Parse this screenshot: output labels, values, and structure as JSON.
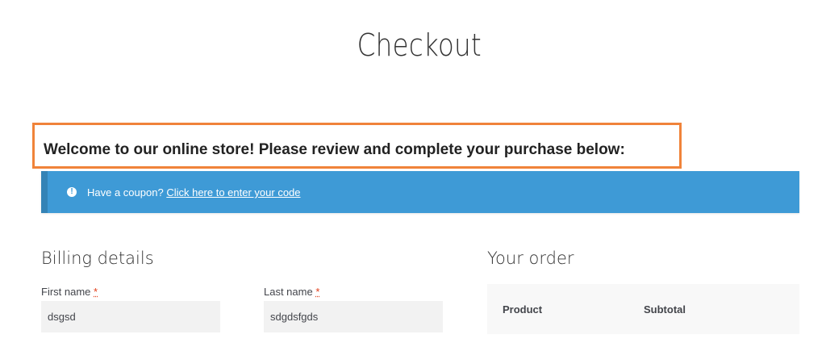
{
  "page": {
    "title": "Checkout"
  },
  "welcome": {
    "text": "Welcome to our online store! Please review and complete your purchase below:"
  },
  "coupon": {
    "icon": "info-icon",
    "prefix": "Have a coupon?",
    "link_text": "Click here to enter your code",
    "background_color": "#3e9ad6"
  },
  "billing": {
    "title": "Billing details",
    "fields": {
      "first_name": {
        "label": "First name",
        "required_mark": "*",
        "value": "dsgsd"
      },
      "last_name": {
        "label": "Last name",
        "required_mark": "*",
        "value": "sdgdsfgds"
      }
    }
  },
  "order": {
    "title": "Your order",
    "columns": [
      "Product",
      "Subtotal"
    ]
  },
  "colors": {
    "highlight_border": "#f0833a",
    "required_mark": "#e2401c"
  }
}
